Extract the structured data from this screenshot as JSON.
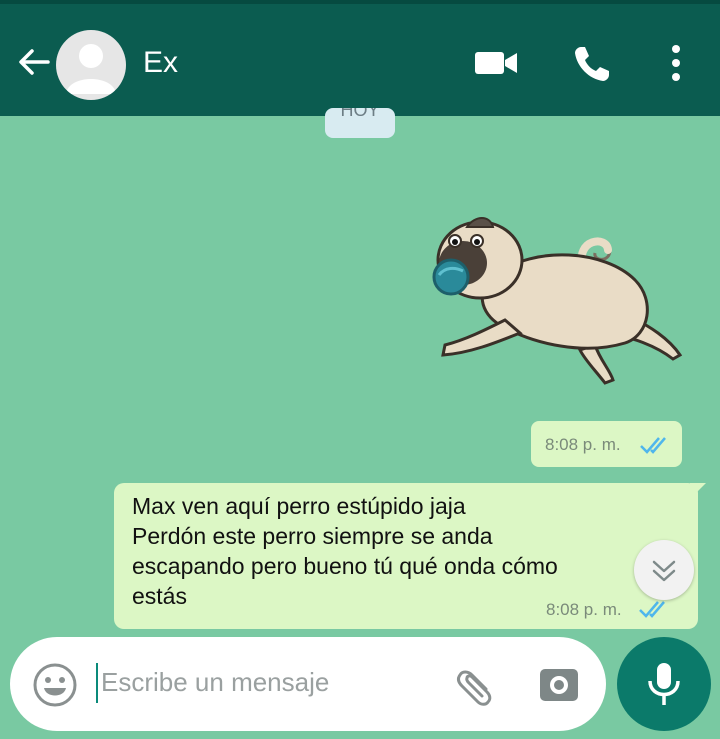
{
  "header": {
    "title": "Ex",
    "back_icon": "arrow-left-icon",
    "avatar_icon": "default-avatar-icon",
    "video_icon": "video-camera-icon",
    "call_icon": "phone-icon",
    "menu_icon": "more-vertical-icon"
  },
  "date_chip": {
    "label": "HOY"
  },
  "messages": [
    {
      "type": "sticker",
      "sticker": "running-pug-with-ball",
      "time": "8:08 p. m.",
      "status_icon": "double-check-read-icon"
    },
    {
      "type": "text",
      "lines": [
        "Max ven aquí perro estúpido jaja",
        "Perdón este perro siempre se  anda",
        "escapando pero bueno tú qué onda cómo",
        "estás"
      ],
      "time": "8:08 p. m.",
      "status_icon": "double-check-read-icon"
    }
  ],
  "scroll_down_icon": "double-chevron-down-icon",
  "composer": {
    "placeholder": "Escribe un mensaje",
    "emoji_icon": "emoji-icon",
    "attach_icon": "paperclip-icon",
    "camera_icon": "camera-icon",
    "mic_icon": "microphone-icon"
  },
  "colors": {
    "header": "#0b5c50",
    "chat_background": "#79c9a2",
    "outgoing_bubble": "#dcf7c5",
    "read_ticks": "#4fb6ec",
    "mic_button": "#0b7a6a"
  }
}
